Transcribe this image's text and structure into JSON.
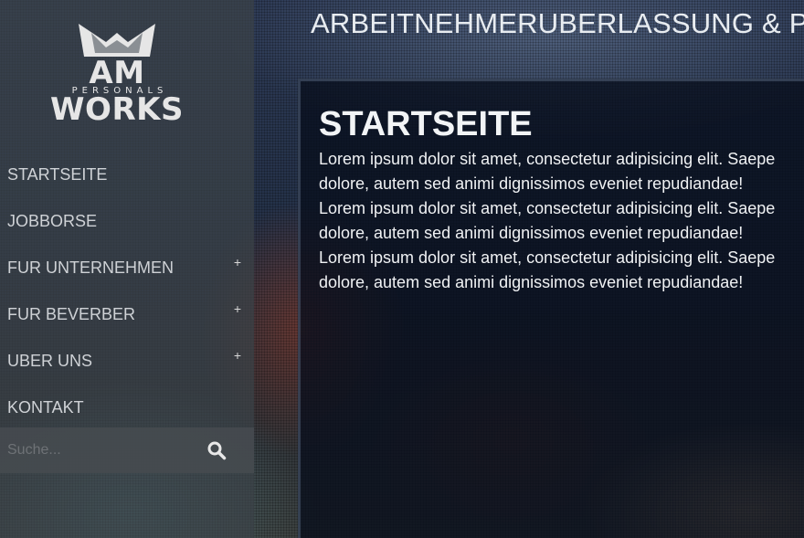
{
  "logo": {
    "name": "AM WORKS",
    "tagline": "PERSONALS"
  },
  "header": {
    "title": "ARBEITNEHMERUBERLASSUNG & PERSONALVERMITTLUNG"
  },
  "nav": [
    {
      "label": "STARTSEITE",
      "expandable": false
    },
    {
      "label": "JOBBORSE",
      "expandable": false
    },
    {
      "label": "FUR UNTERNEHMEN",
      "expandable": true,
      "toggle": "+"
    },
    {
      "label": "FUR BEVERBER",
      "expandable": true,
      "toggle": "+"
    },
    {
      "label": "UBER UNS",
      "expandable": true,
      "toggle": "+"
    },
    {
      "label": "KONTAKT",
      "expandable": false
    }
  ],
  "search": {
    "placeholder": "Suche...",
    "icon": "search-icon"
  },
  "content": {
    "title": "STARTSEITE",
    "lines": [
      "Lorem ipsum dolor sit amet, consectetur adipisicing elit. Saepe",
      "dolore, autem sed animi dignissimos eveniet repudiandae!",
      "Lorem ipsum dolor sit amet, consectetur adipisicing elit. Saepe",
      "dolore, autem sed animi dignissimos eveniet repudiandae!",
      "Lorem ipsum dolor sit amet, consectetur adipisicing elit. Saepe",
      "dolore, autem sed animi dignissimos eveniet repudiandae!"
    ]
  },
  "colors": {
    "sidebar": "#3c4248",
    "panel": "#080e1c",
    "text": "#f0f2f4"
  }
}
